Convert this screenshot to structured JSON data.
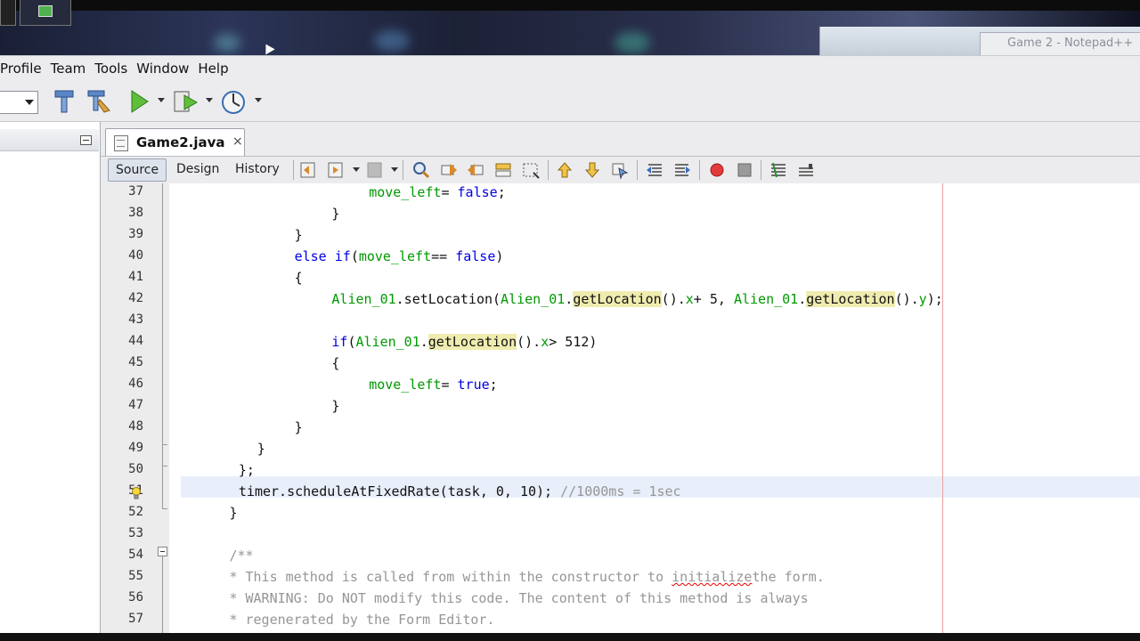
{
  "taskbar": {
    "right_window_title": "Game 2 - Notepad++"
  },
  "menu": [
    "Profile",
    "Team",
    "Tools",
    "Window",
    "Help"
  ],
  "editor": {
    "tab_title": "Game2.java",
    "tab_close": "×",
    "view_tabs": [
      "Source",
      "Design",
      "History"
    ],
    "active_view": "Source"
  },
  "colors": {
    "keyword": "#0000e6",
    "identifier": "#009900",
    "comment": "#969696",
    "highlight": "#f0ecb0",
    "current_line": "#e9effa"
  },
  "line_numbers": [
    "37",
    "38",
    "39",
    "40",
    "41",
    "42",
    "43",
    "44",
    "45",
    "46",
    "47",
    "48",
    "49",
    "50",
    "51",
    "52",
    "53",
    "54",
    "55",
    "56",
    "57"
  ],
  "code": [
    [
      {
        "t": "                "
      },
      {
        "t": "move_left",
        "c": "id"
      },
      {
        "t": " = "
      },
      {
        "t": "false",
        "c": "kw"
      },
      {
        "t": ";"
      }
    ],
    [
      {
        "t": "            }"
      }
    ],
    [
      {
        "t": "        }"
      }
    ],
    [
      {
        "t": "        "
      },
      {
        "t": "else if",
        "c": "kw"
      },
      {
        "t": " ("
      },
      {
        "t": "move_left",
        "c": "id"
      },
      {
        "t": " == "
      },
      {
        "t": "false",
        "c": "kw"
      },
      {
        "t": ")"
      }
    ],
    [
      {
        "t": "        {"
      }
    ],
    [
      {
        "t": "            "
      },
      {
        "t": "Alien_01",
        "c": "id"
      },
      {
        "t": ".setLocation("
      },
      {
        "t": "Alien_01",
        "c": "id"
      },
      {
        "t": "."
      },
      {
        "t": "getLocation",
        "c": "hl"
      },
      {
        "t": "()."
      },
      {
        "t": "x",
        "c": "id"
      },
      {
        "t": " + 5, "
      },
      {
        "t": "Alien_01",
        "c": "id"
      },
      {
        "t": "."
      },
      {
        "t": "getLocation",
        "c": "hl"
      },
      {
        "t": "()."
      },
      {
        "t": "y",
        "c": "id"
      },
      {
        "t": ");"
      }
    ],
    [
      {
        "t": ""
      }
    ],
    [
      {
        "t": "            "
      },
      {
        "t": "if",
        "c": "kw"
      },
      {
        "t": " ("
      },
      {
        "t": "Alien_01",
        "c": "id"
      },
      {
        "t": "."
      },
      {
        "t": "getLocation",
        "c": "hl"
      },
      {
        "t": "()."
      },
      {
        "t": "x",
        "c": "id"
      },
      {
        "t": " > 512)"
      }
    ],
    [
      {
        "t": "            {"
      }
    ],
    [
      {
        "t": "                "
      },
      {
        "t": "move_left",
        "c": "id"
      },
      {
        "t": " = "
      },
      {
        "t": "true",
        "c": "kw"
      },
      {
        "t": ";"
      }
    ],
    [
      {
        "t": "            }"
      }
    ],
    [
      {
        "t": "        }"
      }
    ],
    [
      {
        "t": "    }"
      }
    ],
    [
      {
        "t": "};"
      }
    ],
    [
      {
        "t": "timer.scheduleAtFixedRate(task, 0, 10); "
      },
      {
        "t": "//1000ms = 1sec",
        "c": "cm"
      }
    ],
    [
      {
        "t": "}"
      }
    ],
    [
      {
        "t": ""
      }
    ],
    [
      {
        "t": "/**",
        "c": "cm"
      }
    ],
    [
      {
        "t": " * This method is called from within the constructor to ",
        "c": "cm"
      },
      {
        "t": "initialize",
        "c": "cm wavy"
      },
      {
        "t": " the form.",
        "c": "cm"
      }
    ],
    [
      {
        "t": " * WARNING: Do NOT modify this code. The content of this method is always",
        "c": "cm"
      }
    ],
    [
      {
        "t": " * regenerated by the Form Editor.",
        "c": "cm"
      }
    ]
  ]
}
